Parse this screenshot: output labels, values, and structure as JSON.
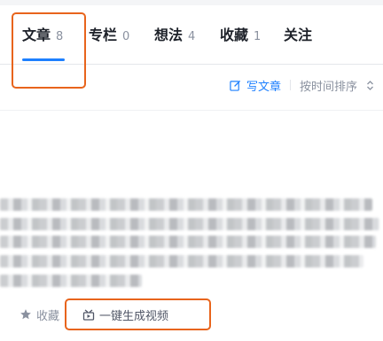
{
  "tabs": [
    {
      "label": "文章",
      "count": "8"
    },
    {
      "label": "专栏",
      "count": "0"
    },
    {
      "label": "想法",
      "count": "4"
    },
    {
      "label": "收藏",
      "count": "1"
    },
    {
      "label": "关注",
      "count": ""
    }
  ],
  "toolbar": {
    "write_label": "写文章",
    "sort_label": "按时间排序"
  },
  "article": {
    "actions": {
      "collect_label": "收藏",
      "generate_video_label": "一键生成视频"
    }
  },
  "colors": {
    "accent": "#1e80ff",
    "highlight": "#e8641c",
    "muted": "#8a919f"
  },
  "icons": {
    "write": "edit-square-icon",
    "sort": "sort-chevrons-icon",
    "collect": "star-icon",
    "video": "video-generate-icon"
  }
}
